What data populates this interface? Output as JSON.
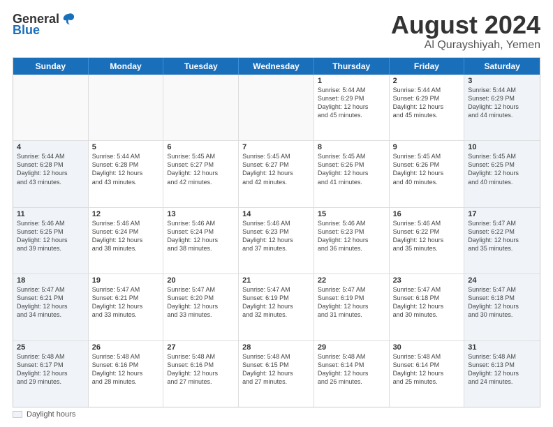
{
  "logo": {
    "general": "General",
    "blue": "Blue"
  },
  "header": {
    "title": "August 2024",
    "subtitle": "Al Qurayshiyah, Yemen"
  },
  "days": [
    "Sunday",
    "Monday",
    "Tuesday",
    "Wednesday",
    "Thursday",
    "Friday",
    "Saturday"
  ],
  "weeks": [
    [
      {
        "day": "",
        "info": ""
      },
      {
        "day": "",
        "info": ""
      },
      {
        "day": "",
        "info": ""
      },
      {
        "day": "",
        "info": ""
      },
      {
        "day": "1",
        "info": "Sunrise: 5:44 AM\nSunset: 6:29 PM\nDaylight: 12 hours\nand 45 minutes."
      },
      {
        "day": "2",
        "info": "Sunrise: 5:44 AM\nSunset: 6:29 PM\nDaylight: 12 hours\nand 45 minutes."
      },
      {
        "day": "3",
        "info": "Sunrise: 5:44 AM\nSunset: 6:29 PM\nDaylight: 12 hours\nand 44 minutes."
      }
    ],
    [
      {
        "day": "4",
        "info": "Sunrise: 5:44 AM\nSunset: 6:28 PM\nDaylight: 12 hours\nand 43 minutes."
      },
      {
        "day": "5",
        "info": "Sunrise: 5:44 AM\nSunset: 6:28 PM\nDaylight: 12 hours\nand 43 minutes."
      },
      {
        "day": "6",
        "info": "Sunrise: 5:45 AM\nSunset: 6:27 PM\nDaylight: 12 hours\nand 42 minutes."
      },
      {
        "day": "7",
        "info": "Sunrise: 5:45 AM\nSunset: 6:27 PM\nDaylight: 12 hours\nand 42 minutes."
      },
      {
        "day": "8",
        "info": "Sunrise: 5:45 AM\nSunset: 6:26 PM\nDaylight: 12 hours\nand 41 minutes."
      },
      {
        "day": "9",
        "info": "Sunrise: 5:45 AM\nSunset: 6:26 PM\nDaylight: 12 hours\nand 40 minutes."
      },
      {
        "day": "10",
        "info": "Sunrise: 5:45 AM\nSunset: 6:25 PM\nDaylight: 12 hours\nand 40 minutes."
      }
    ],
    [
      {
        "day": "11",
        "info": "Sunrise: 5:46 AM\nSunset: 6:25 PM\nDaylight: 12 hours\nand 39 minutes."
      },
      {
        "day": "12",
        "info": "Sunrise: 5:46 AM\nSunset: 6:24 PM\nDaylight: 12 hours\nand 38 minutes."
      },
      {
        "day": "13",
        "info": "Sunrise: 5:46 AM\nSunset: 6:24 PM\nDaylight: 12 hours\nand 38 minutes."
      },
      {
        "day": "14",
        "info": "Sunrise: 5:46 AM\nSunset: 6:23 PM\nDaylight: 12 hours\nand 37 minutes."
      },
      {
        "day": "15",
        "info": "Sunrise: 5:46 AM\nSunset: 6:23 PM\nDaylight: 12 hours\nand 36 minutes."
      },
      {
        "day": "16",
        "info": "Sunrise: 5:46 AM\nSunset: 6:22 PM\nDaylight: 12 hours\nand 35 minutes."
      },
      {
        "day": "17",
        "info": "Sunrise: 5:47 AM\nSunset: 6:22 PM\nDaylight: 12 hours\nand 35 minutes."
      }
    ],
    [
      {
        "day": "18",
        "info": "Sunrise: 5:47 AM\nSunset: 6:21 PM\nDaylight: 12 hours\nand 34 minutes."
      },
      {
        "day": "19",
        "info": "Sunrise: 5:47 AM\nSunset: 6:21 PM\nDaylight: 12 hours\nand 33 minutes."
      },
      {
        "day": "20",
        "info": "Sunrise: 5:47 AM\nSunset: 6:20 PM\nDaylight: 12 hours\nand 33 minutes."
      },
      {
        "day": "21",
        "info": "Sunrise: 5:47 AM\nSunset: 6:19 PM\nDaylight: 12 hours\nand 32 minutes."
      },
      {
        "day": "22",
        "info": "Sunrise: 5:47 AM\nSunset: 6:19 PM\nDaylight: 12 hours\nand 31 minutes."
      },
      {
        "day": "23",
        "info": "Sunrise: 5:47 AM\nSunset: 6:18 PM\nDaylight: 12 hours\nand 30 minutes."
      },
      {
        "day": "24",
        "info": "Sunrise: 5:47 AM\nSunset: 6:18 PM\nDaylight: 12 hours\nand 30 minutes."
      }
    ],
    [
      {
        "day": "25",
        "info": "Sunrise: 5:48 AM\nSunset: 6:17 PM\nDaylight: 12 hours\nand 29 minutes."
      },
      {
        "day": "26",
        "info": "Sunrise: 5:48 AM\nSunset: 6:16 PM\nDaylight: 12 hours\nand 28 minutes."
      },
      {
        "day": "27",
        "info": "Sunrise: 5:48 AM\nSunset: 6:16 PM\nDaylight: 12 hours\nand 27 minutes."
      },
      {
        "day": "28",
        "info": "Sunrise: 5:48 AM\nSunset: 6:15 PM\nDaylight: 12 hours\nand 27 minutes."
      },
      {
        "day": "29",
        "info": "Sunrise: 5:48 AM\nSunset: 6:14 PM\nDaylight: 12 hours\nand 26 minutes."
      },
      {
        "day": "30",
        "info": "Sunrise: 5:48 AM\nSunset: 6:14 PM\nDaylight: 12 hours\nand 25 minutes."
      },
      {
        "day": "31",
        "info": "Sunrise: 5:48 AM\nSunset: 6:13 PM\nDaylight: 12 hours\nand 24 minutes."
      }
    ]
  ],
  "footer": {
    "daylight_label": "Daylight hours"
  },
  "colors": {
    "header_bg": "#1a6fbb",
    "shaded_bg": "#f0f4f8",
    "empty_bg": "#f9f9f9"
  }
}
